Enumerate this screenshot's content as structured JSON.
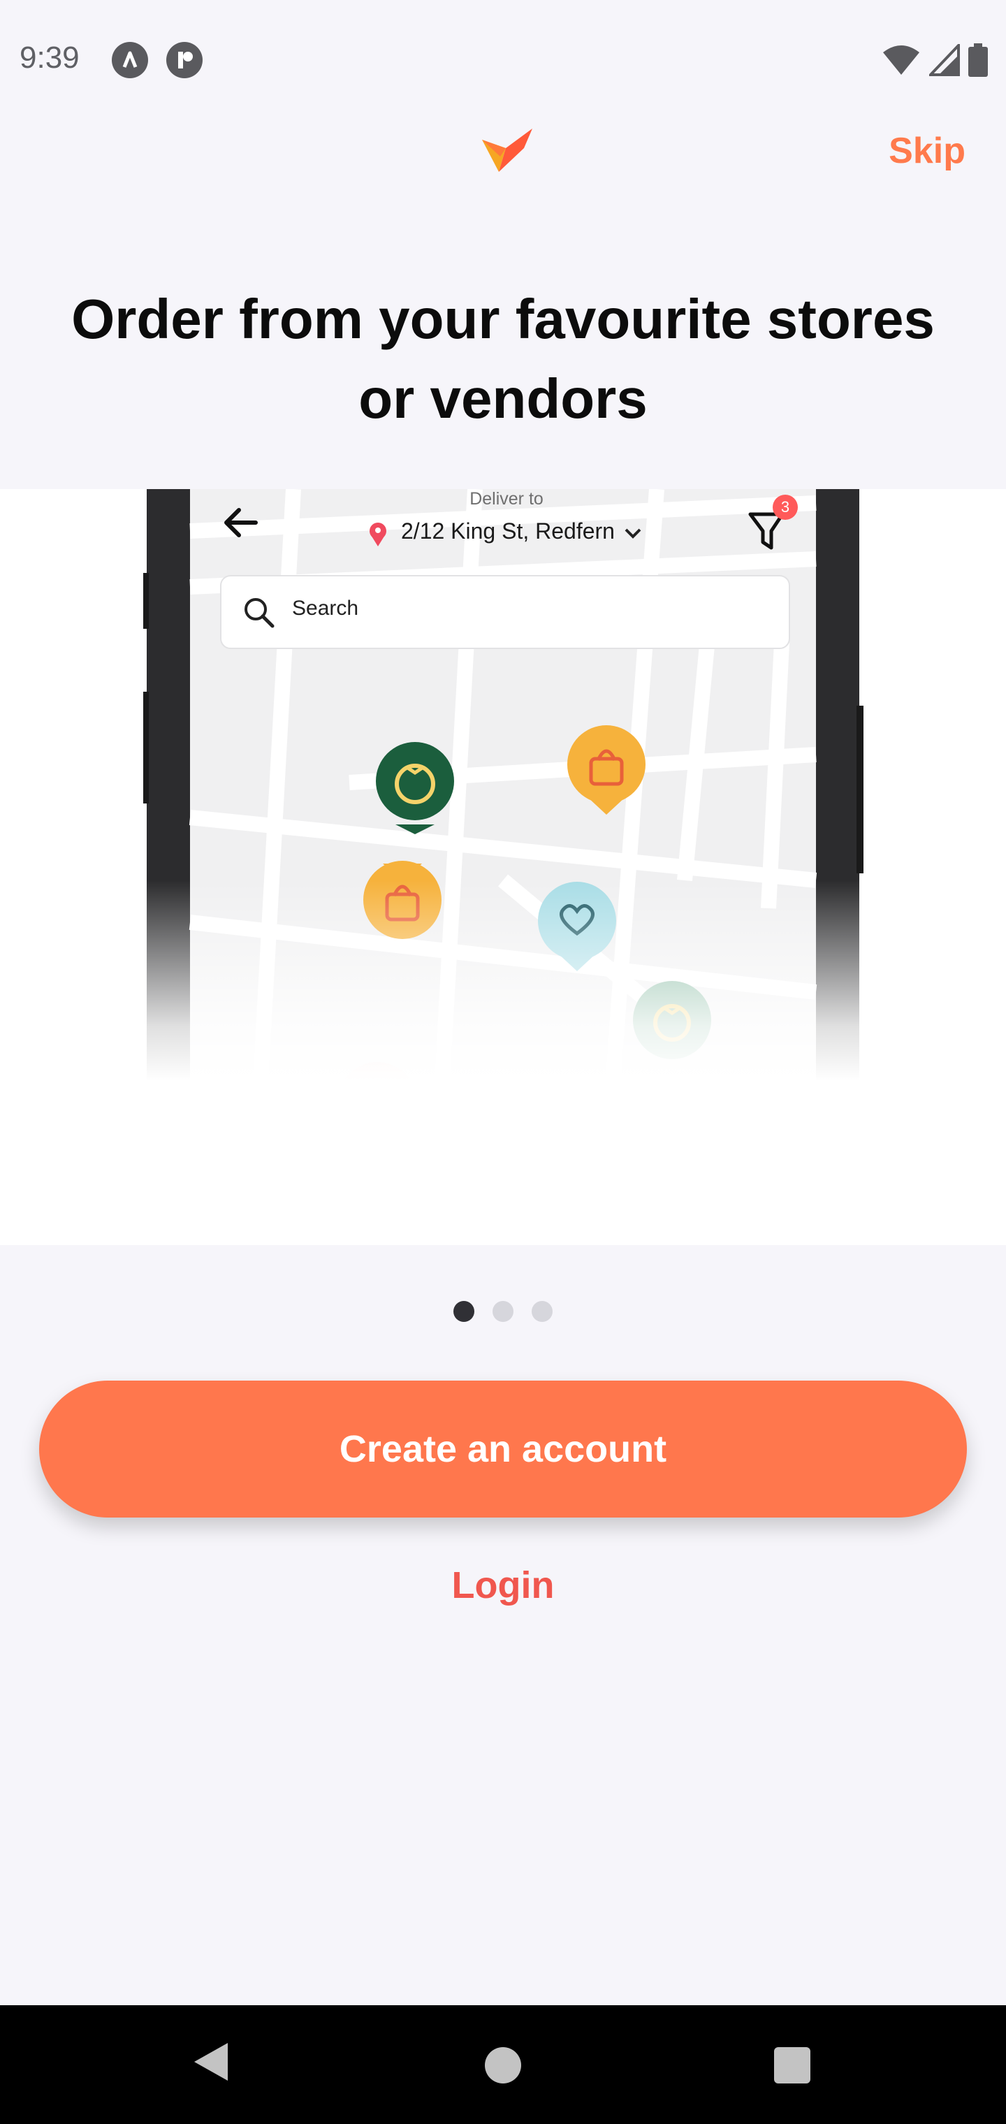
{
  "status_bar": {
    "time": "9:39",
    "left_icons": [
      "app-a-icon",
      "app-r-icon"
    ],
    "right_icons": [
      "wifi-icon",
      "cellular-icon",
      "battery-icon"
    ]
  },
  "header": {
    "logo_icon": "brand-logo-icon",
    "skip_label": "Skip"
  },
  "headline": "Order from your favourite stores or vendors",
  "illustration": {
    "deliver_to_label": "Deliver to",
    "address": "2/12 King St, Redfern",
    "search_placeholder": "Search",
    "filter_badge_count": "3",
    "pins": [
      "grocery-pin-icon",
      "shopping-bag-pin-icon",
      "shopping-bag-pin-icon",
      "heart-pin-icon",
      "grocery-pin-icon",
      "education-pin-icon"
    ]
  },
  "pagination": {
    "total": 3,
    "active_index": 0
  },
  "actions": {
    "create_account_label": "Create an account",
    "login_label": "Login"
  },
  "colors": {
    "accent": "#ff774d",
    "login_text": "#f0574e",
    "background": "#f6f5fa"
  },
  "nav_bar": {
    "icons": [
      "back-icon",
      "home-icon",
      "recents-icon"
    ]
  }
}
